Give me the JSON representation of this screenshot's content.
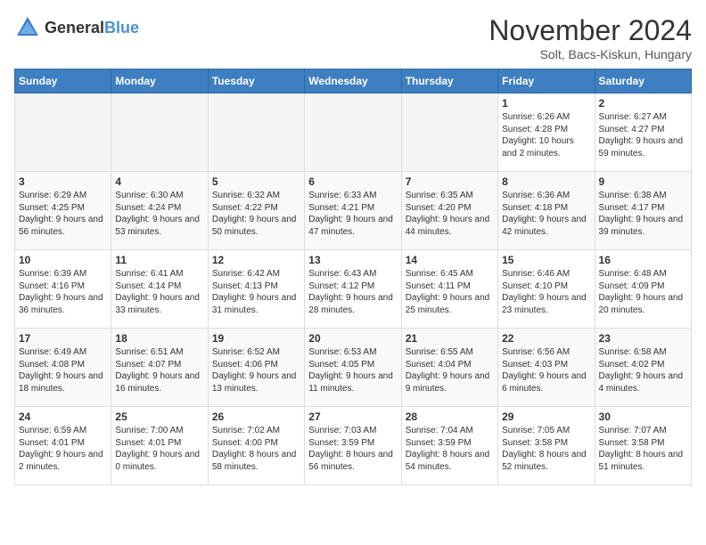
{
  "logo": {
    "text_general": "General",
    "text_blue": "Blue"
  },
  "title": {
    "month": "November 2024",
    "location": "Solt, Bacs-Kiskun, Hungary"
  },
  "weekdays": [
    "Sunday",
    "Monday",
    "Tuesday",
    "Wednesday",
    "Thursday",
    "Friday",
    "Saturday"
  ],
  "weeks": [
    [
      {
        "day": "",
        "sunrise": "",
        "sunset": "",
        "daylight": ""
      },
      {
        "day": "",
        "sunrise": "",
        "sunset": "",
        "daylight": ""
      },
      {
        "day": "",
        "sunrise": "",
        "sunset": "",
        "daylight": ""
      },
      {
        "day": "",
        "sunrise": "",
        "sunset": "",
        "daylight": ""
      },
      {
        "day": "",
        "sunrise": "",
        "sunset": "",
        "daylight": ""
      },
      {
        "day": "1",
        "sunrise": "Sunrise: 6:26 AM",
        "sunset": "Sunset: 4:28 PM",
        "daylight": "Daylight: 10 hours and 2 minutes."
      },
      {
        "day": "2",
        "sunrise": "Sunrise: 6:27 AM",
        "sunset": "Sunset: 4:27 PM",
        "daylight": "Daylight: 9 hours and 59 minutes."
      }
    ],
    [
      {
        "day": "3",
        "sunrise": "Sunrise: 6:29 AM",
        "sunset": "Sunset: 4:25 PM",
        "daylight": "Daylight: 9 hours and 56 minutes."
      },
      {
        "day": "4",
        "sunrise": "Sunrise: 6:30 AM",
        "sunset": "Sunset: 4:24 PM",
        "daylight": "Daylight: 9 hours and 53 minutes."
      },
      {
        "day": "5",
        "sunrise": "Sunrise: 6:32 AM",
        "sunset": "Sunset: 4:22 PM",
        "daylight": "Daylight: 9 hours and 50 minutes."
      },
      {
        "day": "6",
        "sunrise": "Sunrise: 6:33 AM",
        "sunset": "Sunset: 4:21 PM",
        "daylight": "Daylight: 9 hours and 47 minutes."
      },
      {
        "day": "7",
        "sunrise": "Sunrise: 6:35 AM",
        "sunset": "Sunset: 4:20 PM",
        "daylight": "Daylight: 9 hours and 44 minutes."
      },
      {
        "day": "8",
        "sunrise": "Sunrise: 6:36 AM",
        "sunset": "Sunset: 4:18 PM",
        "daylight": "Daylight: 9 hours and 42 minutes."
      },
      {
        "day": "9",
        "sunrise": "Sunrise: 6:38 AM",
        "sunset": "Sunset: 4:17 PM",
        "daylight": "Daylight: 9 hours and 39 minutes."
      }
    ],
    [
      {
        "day": "10",
        "sunrise": "Sunrise: 6:39 AM",
        "sunset": "Sunset: 4:16 PM",
        "daylight": "Daylight: 9 hours and 36 minutes."
      },
      {
        "day": "11",
        "sunrise": "Sunrise: 6:41 AM",
        "sunset": "Sunset: 4:14 PM",
        "daylight": "Daylight: 9 hours and 33 minutes."
      },
      {
        "day": "12",
        "sunrise": "Sunrise: 6:42 AM",
        "sunset": "Sunset: 4:13 PM",
        "daylight": "Daylight: 9 hours and 31 minutes."
      },
      {
        "day": "13",
        "sunrise": "Sunrise: 6:43 AM",
        "sunset": "Sunset: 4:12 PM",
        "daylight": "Daylight: 9 hours and 28 minutes."
      },
      {
        "day": "14",
        "sunrise": "Sunrise: 6:45 AM",
        "sunset": "Sunset: 4:11 PM",
        "daylight": "Daylight: 9 hours and 25 minutes."
      },
      {
        "day": "15",
        "sunrise": "Sunrise: 6:46 AM",
        "sunset": "Sunset: 4:10 PM",
        "daylight": "Daylight: 9 hours and 23 minutes."
      },
      {
        "day": "16",
        "sunrise": "Sunrise: 6:48 AM",
        "sunset": "Sunset: 4:09 PM",
        "daylight": "Daylight: 9 hours and 20 minutes."
      }
    ],
    [
      {
        "day": "17",
        "sunrise": "Sunrise: 6:49 AM",
        "sunset": "Sunset: 4:08 PM",
        "daylight": "Daylight: 9 hours and 18 minutes."
      },
      {
        "day": "18",
        "sunrise": "Sunrise: 6:51 AM",
        "sunset": "Sunset: 4:07 PM",
        "daylight": "Daylight: 9 hours and 16 minutes."
      },
      {
        "day": "19",
        "sunrise": "Sunrise: 6:52 AM",
        "sunset": "Sunset: 4:06 PM",
        "daylight": "Daylight: 9 hours and 13 minutes."
      },
      {
        "day": "20",
        "sunrise": "Sunrise: 6:53 AM",
        "sunset": "Sunset: 4:05 PM",
        "daylight": "Daylight: 9 hours and 11 minutes."
      },
      {
        "day": "21",
        "sunrise": "Sunrise: 6:55 AM",
        "sunset": "Sunset: 4:04 PM",
        "daylight": "Daylight: 9 hours and 9 minutes."
      },
      {
        "day": "22",
        "sunrise": "Sunrise: 6:56 AM",
        "sunset": "Sunset: 4:03 PM",
        "daylight": "Daylight: 9 hours and 6 minutes."
      },
      {
        "day": "23",
        "sunrise": "Sunrise: 6:58 AM",
        "sunset": "Sunset: 4:02 PM",
        "daylight": "Daylight: 9 hours and 4 minutes."
      }
    ],
    [
      {
        "day": "24",
        "sunrise": "Sunrise: 6:59 AM",
        "sunset": "Sunset: 4:01 PM",
        "daylight": "Daylight: 9 hours and 2 minutes."
      },
      {
        "day": "25",
        "sunrise": "Sunrise: 7:00 AM",
        "sunset": "Sunset: 4:01 PM",
        "daylight": "Daylight: 9 hours and 0 minutes."
      },
      {
        "day": "26",
        "sunrise": "Sunrise: 7:02 AM",
        "sunset": "Sunset: 4:00 PM",
        "daylight": "Daylight: 8 hours and 58 minutes."
      },
      {
        "day": "27",
        "sunrise": "Sunrise: 7:03 AM",
        "sunset": "Sunset: 3:59 PM",
        "daylight": "Daylight: 8 hours and 56 minutes."
      },
      {
        "day": "28",
        "sunrise": "Sunrise: 7:04 AM",
        "sunset": "Sunset: 3:59 PM",
        "daylight": "Daylight: 8 hours and 54 minutes."
      },
      {
        "day": "29",
        "sunrise": "Sunrise: 7:05 AM",
        "sunset": "Sunset: 3:58 PM",
        "daylight": "Daylight: 8 hours and 52 minutes."
      },
      {
        "day": "30",
        "sunrise": "Sunrise: 7:07 AM",
        "sunset": "Sunset: 3:58 PM",
        "daylight": "Daylight: 8 hours and 51 minutes."
      }
    ]
  ]
}
